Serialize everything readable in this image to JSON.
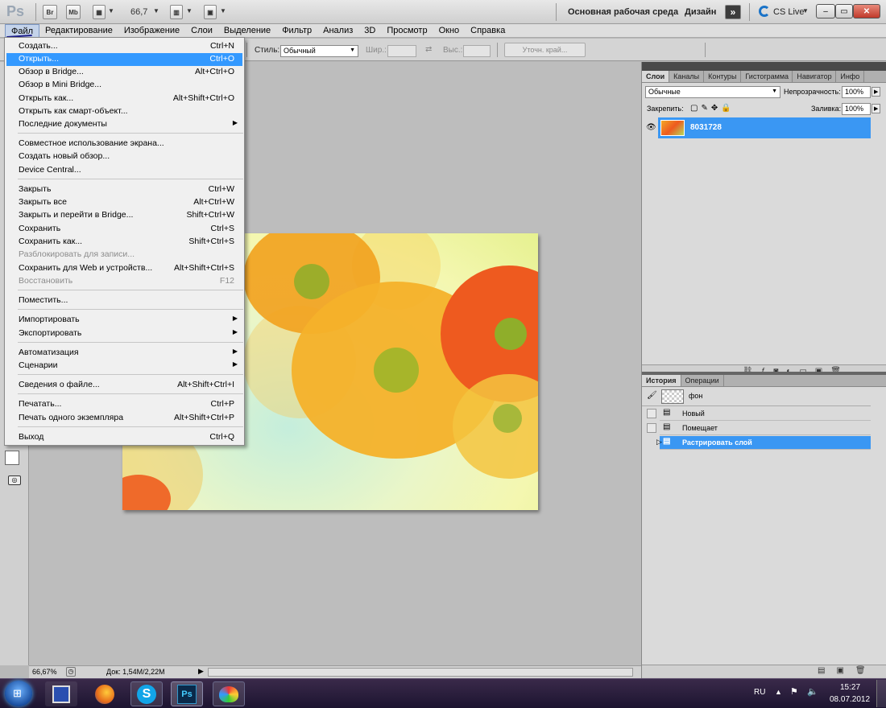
{
  "appbar": {
    "logo": "Ps",
    "btn_br": "Br",
    "btn_mb": "Mb",
    "zoom": "66,7",
    "workspace_label": "Основная рабочая среда",
    "design_label": "Дизайн",
    "cs_live": "CS Live",
    "win_min": "–",
    "win_max": "▭",
    "win_close": "✕"
  },
  "menubar": {
    "items": [
      "Файл",
      "Редактирование",
      "Изображение",
      "Слои",
      "Выделение",
      "Фильтр",
      "Анализ",
      "3D",
      "Просмотр",
      "Окно",
      "Справка"
    ]
  },
  "options": {
    "style_label": "Стиль:",
    "style_value": "Обычный",
    "width_label": "Шир.:",
    "height_label": "Выс.:",
    "refine_label": "Уточн. край..."
  },
  "file_menu": {
    "items": [
      {
        "label": "Создать...",
        "shortcut": "Ctrl+N"
      },
      {
        "label": "Открыть...",
        "shortcut": "Ctrl+O"
      },
      {
        "label": "Обзор в Bridge...",
        "shortcut": "Alt+Ctrl+O"
      },
      {
        "label": "Обзор в Mini Bridge...",
        "shortcut": ""
      },
      {
        "label": "Открыть как...",
        "shortcut": "Alt+Shift+Ctrl+O"
      },
      {
        "label": "Открыть как смарт-объект...",
        "shortcut": ""
      },
      {
        "label": "Последние документы",
        "shortcut": ""
      },
      {
        "label": "Совместное использование экрана...",
        "shortcut": ""
      },
      {
        "label": "Создать новый обзор...",
        "shortcut": ""
      },
      {
        "label": "Device Central...",
        "shortcut": ""
      },
      {
        "label": "Закрыть",
        "shortcut": "Ctrl+W"
      },
      {
        "label": "Закрыть все",
        "shortcut": "Alt+Ctrl+W"
      },
      {
        "label": "Закрыть и перейти в Bridge...",
        "shortcut": "Shift+Ctrl+W"
      },
      {
        "label": "Сохранить",
        "shortcut": "Ctrl+S"
      },
      {
        "label": "Сохранить как...",
        "shortcut": "Shift+Ctrl+S"
      },
      {
        "label": "Разблокировать для записи...",
        "shortcut": ""
      },
      {
        "label": "Сохранить для Web и устройств...",
        "shortcut": "Alt+Shift+Ctrl+S"
      },
      {
        "label": "Восстановить",
        "shortcut": "F12"
      },
      {
        "label": "Поместить...",
        "shortcut": ""
      },
      {
        "label": "Импортировать",
        "shortcut": ""
      },
      {
        "label": "Экспортировать",
        "shortcut": ""
      },
      {
        "label": "Автоматизация",
        "shortcut": ""
      },
      {
        "label": "Сценарии",
        "shortcut": ""
      },
      {
        "label": "Сведения о файле...",
        "shortcut": "Alt+Shift+Ctrl+I"
      },
      {
        "label": "Печатать...",
        "shortcut": "Ctrl+P"
      },
      {
        "label": "Печать одного экземпляра",
        "shortcut": "Alt+Shift+Ctrl+P"
      },
      {
        "label": "Выход",
        "shortcut": "Ctrl+Q"
      }
    ]
  },
  "layers_panel": {
    "tabs": [
      "Слои",
      "Каналы",
      "Контуры",
      "Гистограмма",
      "Навигатор",
      "Инфо"
    ],
    "blend_mode": "Обычные",
    "opacity_label": "Непрозрачность:",
    "opacity_value": "100%",
    "lock_label": "Закрепить:",
    "fill_label": "Заливка:",
    "fill_value": "100%",
    "layer_name": "8031728"
  },
  "history_panel": {
    "tabs": [
      "История",
      "Операции"
    ],
    "snapshot": "фон",
    "steps": [
      "Новый",
      "Помещает",
      "Растрировать слой"
    ]
  },
  "status": {
    "zoom": "66,67%",
    "doc": "Док: 1,54M/2,22M"
  },
  "taskbar": {
    "lang": "RU",
    "time": "15:27",
    "date": "08.07.2012",
    "ps_icon": "Ps"
  }
}
